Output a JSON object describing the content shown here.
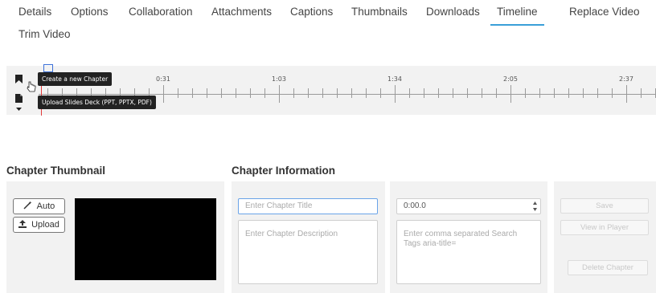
{
  "tabs": [
    {
      "label": "Details",
      "active": false
    },
    {
      "label": "Options",
      "active": false
    },
    {
      "label": "Collaboration",
      "active": false
    },
    {
      "label": "Attachments",
      "active": false
    },
    {
      "label": "Captions",
      "active": false
    },
    {
      "label": "Thumbnails",
      "active": false
    },
    {
      "label": "Downloads",
      "active": false
    },
    {
      "label": "Timeline",
      "active": true
    },
    {
      "label": "Replace Video",
      "active": false
    },
    {
      "label": "Trim Video",
      "active": false
    }
  ],
  "timeline": {
    "tick_labels": [
      "0:31",
      "1:03",
      "1:34",
      "2:05",
      "2:37"
    ],
    "tools": {
      "chapter_icon": "bookmark-icon",
      "slides_icon": "document-icon",
      "more_icon": "caret-down-icon"
    },
    "tooltips": {
      "chapter": "Create a new Chapter",
      "slides": "Upload Slides Deck (PPT, PPTX, PDF)"
    }
  },
  "thumbnail": {
    "title": "Chapter Thumbnail",
    "auto_label": "Auto",
    "upload_label": "Upload"
  },
  "info": {
    "title": "Chapter Information",
    "title_placeholder": "Enter Chapter Title",
    "description_placeholder": "Enter Chapter Description",
    "time_value": "0:00.0",
    "tags_placeholder": "Enter comma separated Search Tags aria-title="
  },
  "actions": {
    "save": "Save",
    "view": "View in Player",
    "delete": "Delete Chapter"
  },
  "colors": {
    "accent": "#3a9fd8",
    "cursor": "#e23b3b",
    "panel": "#f2f2f2"
  }
}
